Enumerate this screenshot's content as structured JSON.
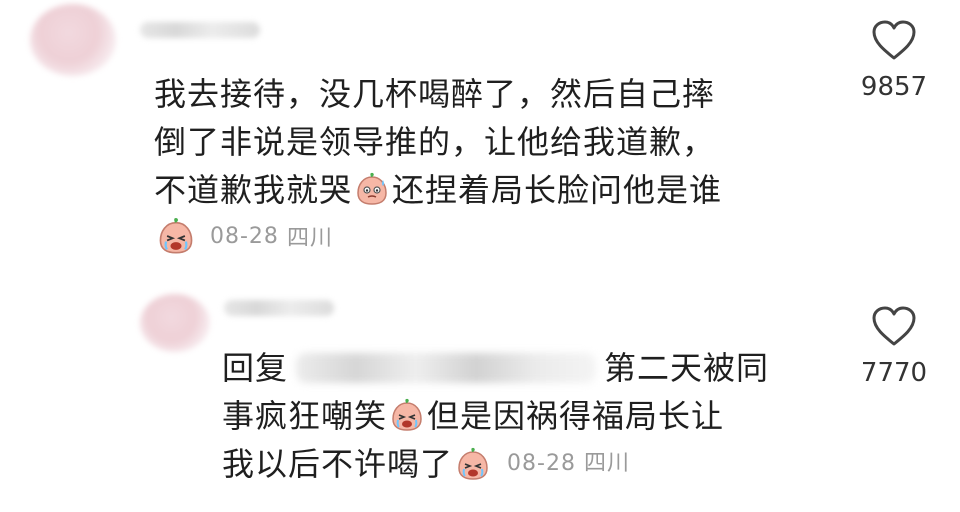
{
  "comment1": {
    "line1": "我去接待，没几杯喝醉了，然后自己摔",
    "line2": "倒了非说是领导推的，让他给我道歉，",
    "line3a": "不道歉我就哭",
    "line3b": "还捏着局长脸问他是谁",
    "date": "08-28",
    "location": "四川",
    "likes": "9857"
  },
  "comment2": {
    "reply_label": "回复",
    "line1": "第二天被同",
    "line2a": "事疯狂嘲笑",
    "line2b": "但是因祸得福局长让",
    "line3": "我以后不许喝了",
    "date": "08-28",
    "location": "四川",
    "likes": "7770"
  },
  "icons": {
    "heart": "heart-outline-icon",
    "emoji_cry": "crying-emoji-icon",
    "emoji_sweat": "sweating-emoji-icon"
  },
  "colors": {
    "text": "#1f1f1f",
    "meta": "#9a9a9a",
    "emoji_skin": "#f6b7a6",
    "emoji_leaf": "#4caf50"
  }
}
